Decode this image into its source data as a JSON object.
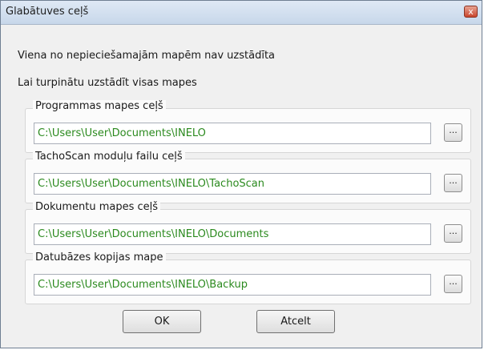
{
  "window": {
    "title": "Glabātuves ceļš",
    "close_label": "x"
  },
  "message": {
    "line1": "Viena no nepieciešamajām mapēm nav uzstādīta",
    "line2": "Lai turpinātu uzstādīt visas mapes"
  },
  "groups": [
    {
      "label": "Programmas mapes ceļš",
      "value": "C:\\Users\\User\\Documents\\INELO"
    },
    {
      "label": "TachoScan moduļu failu ceļš",
      "value": "C:\\Users\\User\\Documents\\INELO\\TachoScan"
    },
    {
      "label": "Dokumentu mapes ceļš",
      "value": "C:\\Users\\User\\Documents\\INELO\\Documents"
    },
    {
      "label": "Datubāzes kopijas mape",
      "value": "C:\\Users\\User\\Documents\\INELO\\Backup"
    }
  ],
  "browse_label": "...",
  "buttons": {
    "ok": "OK",
    "cancel": "Atcelt"
  },
  "colors": {
    "path_text": "#2b8a1e",
    "titlebar": "#c7d7ea",
    "close": "#c9452c"
  }
}
